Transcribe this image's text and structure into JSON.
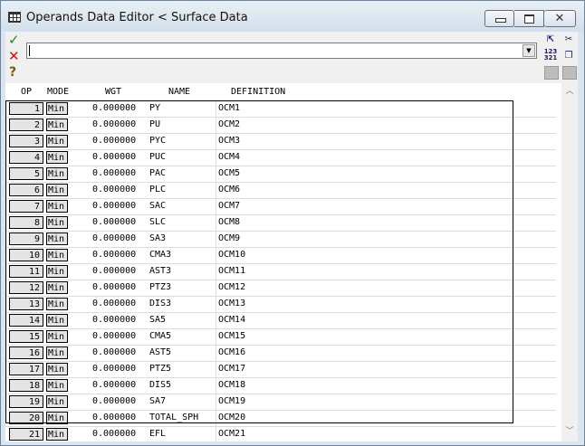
{
  "window": {
    "title": "Operands Data Editor < Surface Data"
  },
  "toolbar": {
    "accept_icon": "✓",
    "reject_icon": "✕",
    "help_icon": "?",
    "input_value": ""
  },
  "grid": {
    "headers": {
      "op": "OP",
      "mode": "MODE",
      "wgt": "WGT",
      "name": "NAME",
      "definition": "DEFINITION"
    },
    "rows": [
      {
        "op": "1",
        "mode": "Min",
        "wgt": "0.000000",
        "name": "PY",
        "def": "OCM1"
      },
      {
        "op": "2",
        "mode": "Min",
        "wgt": "0.000000",
        "name": "PU",
        "def": "OCM2"
      },
      {
        "op": "3",
        "mode": "Min",
        "wgt": "0.000000",
        "name": "PYC",
        "def": "OCM3"
      },
      {
        "op": "4",
        "mode": "Min",
        "wgt": "0.000000",
        "name": "PUC",
        "def": "OCM4"
      },
      {
        "op": "5",
        "mode": "Min",
        "wgt": "0.000000",
        "name": "PAC",
        "def": "OCM5"
      },
      {
        "op": "6",
        "mode": "Min",
        "wgt": "0.000000",
        "name": "PLC",
        "def": "OCM6"
      },
      {
        "op": "7",
        "mode": "Min",
        "wgt": "0.000000",
        "name": "SAC",
        "def": "OCM7"
      },
      {
        "op": "8",
        "mode": "Min",
        "wgt": "0.000000",
        "name": "SLC",
        "def": "OCM8"
      },
      {
        "op": "9",
        "mode": "Min",
        "wgt": "0.000000",
        "name": "SA3",
        "def": "OCM9"
      },
      {
        "op": "10",
        "mode": "Min",
        "wgt": "0.000000",
        "name": "CMA3",
        "def": "OCM10"
      },
      {
        "op": "11",
        "mode": "Min",
        "wgt": "0.000000",
        "name": "AST3",
        "def": "OCM11"
      },
      {
        "op": "12",
        "mode": "Min",
        "wgt": "0.000000",
        "name": "PTZ3",
        "def": "OCM12"
      },
      {
        "op": "13",
        "mode": "Min",
        "wgt": "0.000000",
        "name": "DIS3",
        "def": "OCM13"
      },
      {
        "op": "14",
        "mode": "Min",
        "wgt": "0.000000",
        "name": "SA5",
        "def": "OCM14"
      },
      {
        "op": "15",
        "mode": "Min",
        "wgt": "0.000000",
        "name": "CMA5",
        "def": "OCM15"
      },
      {
        "op": "16",
        "mode": "Min",
        "wgt": "0.000000",
        "name": "AST5",
        "def": "OCM16"
      },
      {
        "op": "17",
        "mode": "Min",
        "wgt": "0.000000",
        "name": "PTZ5",
        "def": "OCM17"
      },
      {
        "op": "18",
        "mode": "Min",
        "wgt": "0.000000",
        "name": "DIS5",
        "def": "OCM18"
      },
      {
        "op": "19",
        "mode": "Min",
        "wgt": "0.000000",
        "name": "SA7",
        "def": "OCM19"
      },
      {
        "op": "20",
        "mode": "Min",
        "wgt": "0.000000",
        "name": "TOTAL_SPH",
        "def": "OCM20"
      },
      {
        "op": "21",
        "mode": "Min",
        "wgt": "0.000000",
        "name": "EFL",
        "def": "OCM21"
      }
    ]
  },
  "icons": {
    "app": "table-icon",
    "minimize": "minimize-icon",
    "maximize": "maximize-icon",
    "close": "close-icon",
    "insert_row": "insert-row-icon",
    "cut": "scissors-icon",
    "sort": "sort-numeric-icon",
    "copy": "copy-icon",
    "delete_row": "delete-row-icon",
    "paste": "paste-icon",
    "scroll_up": "chevron-up-icon",
    "scroll_down": "chevron-down-icon"
  },
  "colors": {
    "accept": "#2b8a1b",
    "reject": "#c81818",
    "help": "#7a5c00"
  }
}
